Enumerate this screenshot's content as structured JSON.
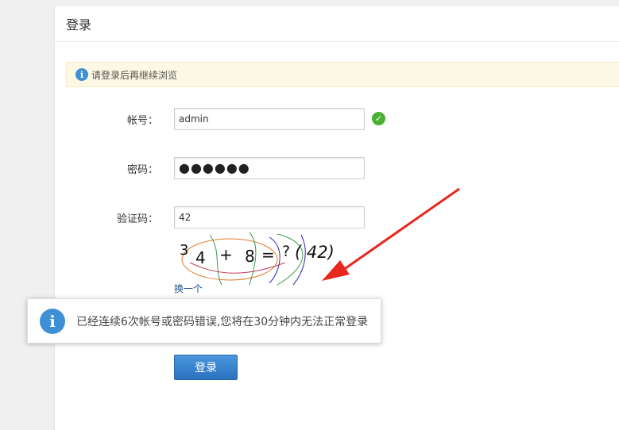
{
  "header": {
    "title": "登录"
  },
  "alert": {
    "icon": "info-icon",
    "text": "请登录后再继续浏览"
  },
  "form": {
    "username_label": "帐号：",
    "username_value": "admin",
    "password_label": "密码：",
    "password_value": "●●●●●●",
    "captcha_label": "验证码：",
    "captcha_value": "42",
    "captcha_image": {
      "d1": "3",
      "d2": "4",
      "op": "+",
      "d3": "8",
      "eq": "=",
      "q": "?",
      "ans": "( 42)"
    },
    "refresh_label": "换一个",
    "submit_label": "登录"
  },
  "toast": {
    "icon": "info-icon",
    "text": "已经连续6次帐号或密码错误,您将在30分钟内无法正常登录"
  },
  "colors": {
    "accent": "#2c72c0",
    "success": "#4caf35",
    "annotation": "#e8281e",
    "alert_bg": "#fcf8e3"
  }
}
